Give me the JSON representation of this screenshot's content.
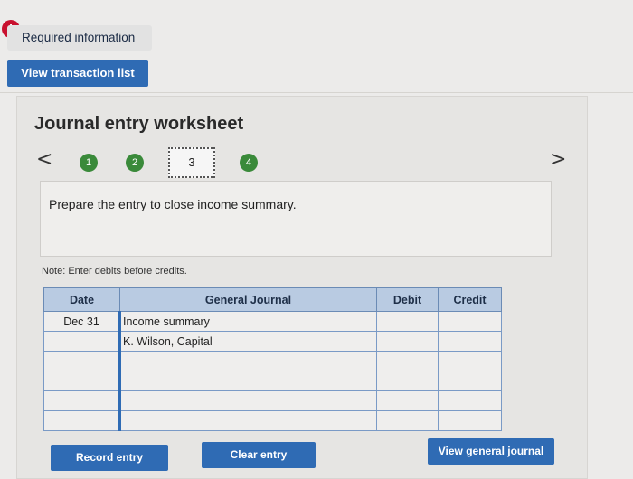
{
  "header": {
    "alert_glyph": "!",
    "required_label": "Required information",
    "view_transactions_label": "View transaction list"
  },
  "worksheet": {
    "title": "Journal entry worksheet",
    "nav_prev": "<",
    "nav_next": ">",
    "steps": [
      "1",
      "2",
      "3",
      "4"
    ],
    "current_step": "3",
    "instruction": "Prepare the entry to close income summary.",
    "note": "Note: Enter debits before credits."
  },
  "table": {
    "headers": {
      "date": "Date",
      "journal": "General Journal",
      "debit": "Debit",
      "credit": "Credit"
    },
    "rows": [
      {
        "date": "Dec 31",
        "account": "Income summary",
        "debit": "",
        "credit": ""
      },
      {
        "date": "",
        "account": "K. Wilson, Capital",
        "debit": "",
        "credit": ""
      },
      {
        "date": "",
        "account": "",
        "debit": "",
        "credit": ""
      },
      {
        "date": "",
        "account": "",
        "debit": "",
        "credit": ""
      },
      {
        "date": "",
        "account": "",
        "debit": "",
        "credit": ""
      },
      {
        "date": "",
        "account": "",
        "debit": "",
        "credit": ""
      }
    ]
  },
  "buttons": {
    "record": "Record entry",
    "clear": "Clear entry",
    "view_journal": "View general journal"
  },
  "colors": {
    "accent": "#2f6bb4",
    "step_done": "#3a8a3a",
    "alert": "#c8102e",
    "table_header": "#b9cbe2"
  }
}
